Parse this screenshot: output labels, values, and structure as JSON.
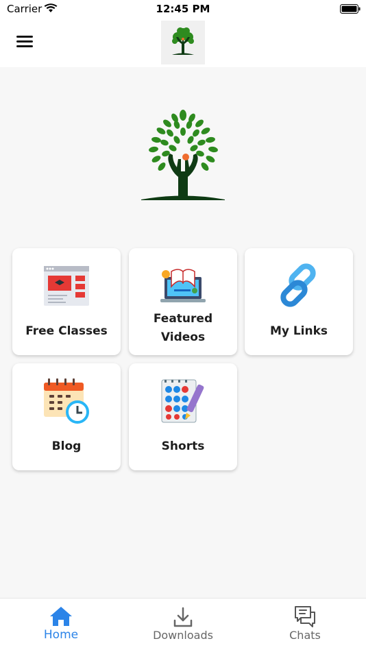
{
  "status": {
    "carrier": "Carrier",
    "time": "12:45 PM"
  },
  "header": {
    "menu_icon": "hamburger-menu-icon",
    "logo": "tree-hands-logo"
  },
  "colors": {
    "accent": "#2c84e8",
    "leaf_green": "#2e8b1f",
    "trunk": "#0f3b14",
    "orange_dot": "#ef6c2f",
    "card_bg": "#ffffff",
    "page_bg": "#f7f7f7"
  },
  "cards": [
    {
      "label": "Free Classes",
      "icon": "video-classes-icon"
    },
    {
      "label": "Featured Videos",
      "icon": "laptop-book-icon"
    },
    {
      "label": "My Links",
      "icon": "chain-link-icon"
    },
    {
      "label": "Blog",
      "icon": "calendar-clock-icon"
    },
    {
      "label": "Shorts",
      "icon": "notes-pen-icon"
    }
  ],
  "tabs": [
    {
      "label": "Home",
      "icon": "home-icon",
      "active": true
    },
    {
      "label": "Downloads",
      "icon": "download-icon",
      "active": false
    },
    {
      "label": "Chats",
      "icon": "chat-bubbles-icon",
      "active": false
    }
  ]
}
